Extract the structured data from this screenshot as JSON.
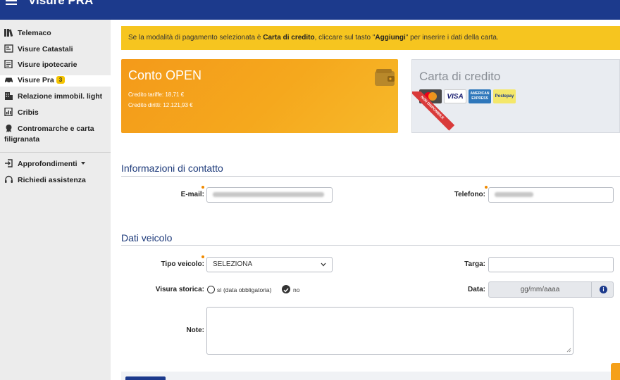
{
  "header": {
    "title": "Visure PRA"
  },
  "sidebar": {
    "items": [
      {
        "label": "Telemaco",
        "icon": "books-icon"
      },
      {
        "label": "Visure Catastali",
        "icon": "map-icon"
      },
      {
        "label": "Visure ipotecarie",
        "icon": "document-icon"
      },
      {
        "label": "Visure Pra",
        "icon": "car-icon",
        "badge": "3"
      },
      {
        "label": "Relazione immobil. light",
        "icon": "building-icon"
      },
      {
        "label": "Cribis",
        "icon": "chart-doc-icon"
      },
      {
        "label": "Contromarche e carta",
        "label2": "filigranata",
        "icon": "seal-icon"
      },
      {
        "label": "Approfondimenti",
        "icon": "login-icon"
      },
      {
        "label": "Richiedi assistenza",
        "icon": "headset-icon"
      }
    ]
  },
  "notice": {
    "part1": "Se la modalità di pagamento selezionata è ",
    "bold1": "Carta di credito",
    "part2": ", cliccare sul tasto \"",
    "bold2": "Aggiungi",
    "part3": "\" per inserire i dati della carta."
  },
  "payment": {
    "open": {
      "title": "Conto OPEN",
      "credito_tariffe": "Credito tariffe: 18,71 €",
      "credito_diritti": "Credito diritti: 12.121,93 €",
      "icon": "wallet-icon"
    },
    "credit_card": {
      "title": "Carta di credito",
      "ribbon": "NON DISPONIBILE",
      "logos": [
        "MasterCard",
        "VISA",
        "AMERICAN EXPRESS",
        "Postepay"
      ]
    }
  },
  "contact": {
    "section_title": "Informazioni di contatto",
    "email_label": "E-mail:",
    "phone_label": "Telefono:"
  },
  "vehicle": {
    "section_title": "Dati veicolo",
    "type_label": "Tipo veicolo:",
    "type_value": "SELEZIONA",
    "plate_label": "Targa:",
    "history_label": "Visura storica:",
    "history_yes": "sì (data obbligatoria)",
    "history_no": "no",
    "date_label": "Data:",
    "date_placeholder": "gg/mm/aaaa",
    "notes_label": "Note:"
  },
  "colors": {
    "header": "#1c3a8c",
    "accent_yellow": "#f6c51f",
    "open_card": "#f49a1a",
    "section_title": "#1d3a7a",
    "required_dot": "#f08a00"
  }
}
